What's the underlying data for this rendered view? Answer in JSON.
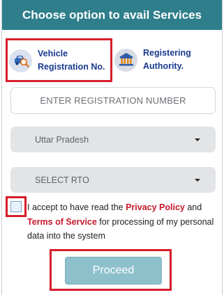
{
  "header": {
    "title": "Choose option to avail Services"
  },
  "options": [
    {
      "label_line1": "Vehicle",
      "label_line2": "Registration No.",
      "icon": "car-search-icon"
    },
    {
      "label_line1": "Registering",
      "label_line2": "Authority.",
      "icon": "government-building-icon"
    }
  ],
  "registration_input": {
    "placeholder": "ENTER REGISTRATION NUMBER"
  },
  "state_select": {
    "value": "Uttar Pradesh"
  },
  "rto_select": {
    "value": "SELECT RTO"
  },
  "consent": {
    "text_before": "I accept to have read the ",
    "privacy_link": "Privacy Policy",
    "text_middle": " and ",
    "terms_link": "Terms of Service",
    "text_after": " for processing of my personal data into the system"
  },
  "proceed_button": {
    "label": "Proceed"
  },
  "colors": {
    "header_bg": "#2e7f8b",
    "highlight_red": "#d71e2b",
    "link_red": "#c7182a",
    "option_text": "#1a3a8f",
    "proceed_bg": "#8ec0cc"
  }
}
